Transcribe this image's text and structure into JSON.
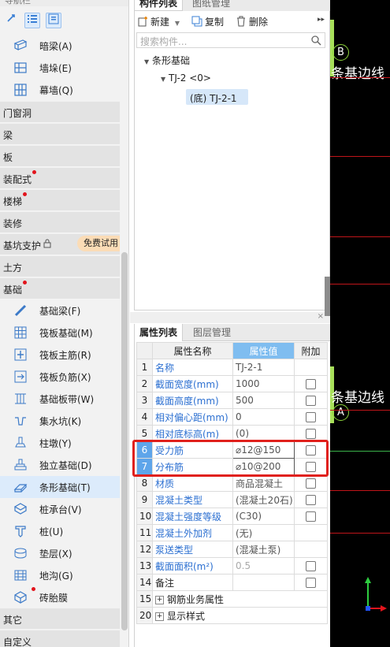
{
  "nav": {
    "title": "导航栏",
    "items_top": [
      {
        "label": "暗梁(A)",
        "icon": "beam-icon"
      },
      {
        "label": "墙垛(E)",
        "icon": "wall-pier-icon"
      },
      {
        "label": "幕墙(Q)",
        "icon": "curtain-wall-icon"
      }
    ],
    "categories": [
      {
        "label": "门窗洞",
        "dot": false
      },
      {
        "label": "梁",
        "dot": false
      },
      {
        "label": "板",
        "dot": false
      },
      {
        "label": "装配式",
        "dot": true
      },
      {
        "label": "楼梯",
        "dot": true
      },
      {
        "label": "装修",
        "dot": false
      },
      {
        "label": "基坑支护",
        "dot": false,
        "badge": "免费试用"
      },
      {
        "label": "土方",
        "dot": false
      },
      {
        "label": "基础",
        "dot": true
      }
    ],
    "items_foundation": [
      {
        "label": "基础梁(F)",
        "icon": "foundation-beam-icon"
      },
      {
        "label": "筏板基础(M)",
        "icon": "raft-foundation-icon"
      },
      {
        "label": "筏板主筋(R)",
        "icon": "raft-main-rebar-icon"
      },
      {
        "label": "筏板负筋(X)",
        "icon": "raft-negative-rebar-icon"
      },
      {
        "label": "基础板带(W)",
        "icon": "foundation-strip-board-icon"
      },
      {
        "label": "集水坑(K)",
        "icon": "sump-pit-icon"
      },
      {
        "label": "柱墩(Y)",
        "icon": "column-pier-icon"
      },
      {
        "label": "独立基础(D)",
        "icon": "isolated-footing-icon"
      },
      {
        "label": "条形基础(T)",
        "icon": "strip-foundation-icon"
      },
      {
        "label": "桩承台(V)",
        "icon": "pile-cap-icon"
      },
      {
        "label": "桩(U)",
        "icon": "pile-icon"
      },
      {
        "label": "垫层(X)",
        "icon": "cushion-layer-icon"
      },
      {
        "label": "地沟(G)",
        "icon": "trench-icon"
      },
      {
        "label": "砖胎膜",
        "icon": "brick-mold-icon"
      }
    ],
    "categories_bottom": [
      {
        "label": "其它"
      },
      {
        "label": "自定义"
      }
    ]
  },
  "component_list": {
    "tabs": [
      "构件列表",
      "图纸管理"
    ],
    "toolbar": {
      "new": "新建",
      "copy": "复制",
      "delete": "删除"
    },
    "search_placeholder": "搜索构件...",
    "tree": {
      "root": "条形基础",
      "child": "TJ-2 <0>",
      "leaf": "(底) TJ-2-1"
    }
  },
  "property_list": {
    "tabs": [
      "属性列表",
      "图层管理"
    ],
    "headers": {
      "name": "属性名称",
      "value": "属性值",
      "extra": "附加"
    },
    "rows": [
      {
        "num": "1",
        "name": "名称",
        "value": "TJ-2-1",
        "checkbox": false,
        "style": "blue"
      },
      {
        "num": "2",
        "name": "截面宽度(mm)",
        "value": "1000",
        "checkbox": true,
        "style": "blue"
      },
      {
        "num": "3",
        "name": "截面高度(mm)",
        "value": "500",
        "checkbox": true,
        "style": "blue"
      },
      {
        "num": "4",
        "name": "相对偏心距(mm)",
        "value": "0",
        "checkbox": true,
        "style": "blue"
      },
      {
        "num": "5",
        "name": "相对底标高(m)",
        "value": "(0)",
        "checkbox": true,
        "style": "blue"
      },
      {
        "num": "6",
        "name": "受力筋",
        "value": "⌀12@150",
        "checkbox": true,
        "style": "blue",
        "highlight": true
      },
      {
        "num": "7",
        "name": "分布筋",
        "value": "⌀10@200",
        "checkbox": true,
        "style": "blue",
        "highlight": true
      },
      {
        "num": "8",
        "name": "材质",
        "value": "商品混凝土",
        "checkbox": true,
        "style": "blue"
      },
      {
        "num": "9",
        "name": "混凝土类型",
        "value": "(混凝土20石)",
        "checkbox": true,
        "style": "blue"
      },
      {
        "num": "10",
        "name": "混凝土强度等级",
        "value": "(C30)",
        "checkbox": true,
        "style": "blue"
      },
      {
        "num": "11",
        "name": "混凝土外加剂",
        "value": "(无)",
        "checkbox": false,
        "style": "blue"
      },
      {
        "num": "12",
        "name": "泵送类型",
        "value": "(混凝土泵)",
        "checkbox": false,
        "style": "blue"
      },
      {
        "num": "13",
        "name": "截面面积(m²)",
        "value": "0.5",
        "checkbox": true,
        "style": "blue",
        "value_muted": true
      },
      {
        "num": "14",
        "name": "备注",
        "value": "",
        "checkbox": true,
        "style": "plain"
      },
      {
        "num": "15",
        "name": "钢筋业务属性",
        "value": "",
        "checkbox": false,
        "style": "plain",
        "expand": true
      },
      {
        "num": "20",
        "name": "显示样式",
        "value": "",
        "checkbox": false,
        "style": "plain",
        "expand": true
      }
    ]
  },
  "canvas": {
    "axis_b": "B",
    "axis_a": "A",
    "label_top": "条基边线",
    "label_bottom": "条基边线",
    "line_color": "#c0151a",
    "green_color": "#3cb44b"
  }
}
